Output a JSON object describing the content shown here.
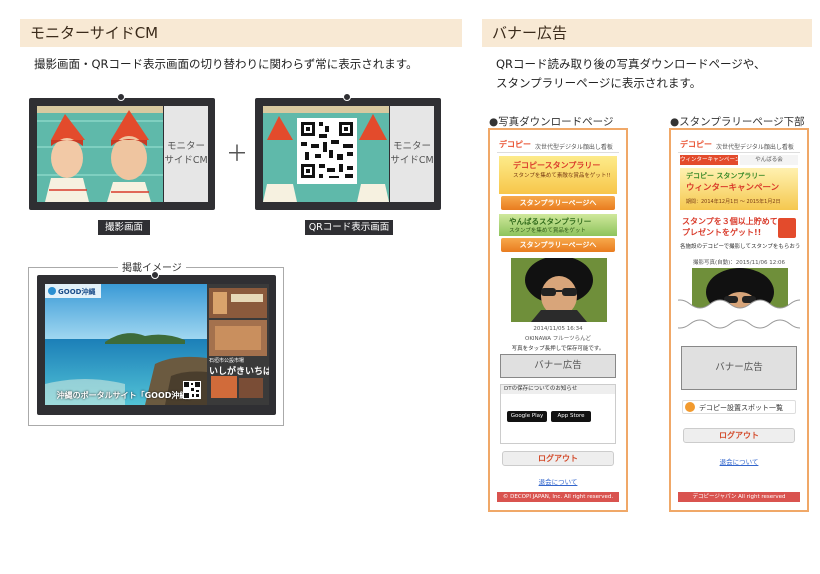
{
  "left": {
    "title": "モニターサイドCM",
    "description": "撮影画面・QRコード表示画面の切り替わりに関わらず常に表示されます。",
    "monitor1": {
      "cm_label": "モニター\nサイドCM",
      "caption": "撮影画面"
    },
    "plus": "＋",
    "monitor2": {
      "cm_label": "モニター\nサイドCM",
      "caption": "QRコード表示画面"
    },
    "image_label": "掲載イメージ",
    "ad": {
      "logo": "GOOD沖縄",
      "headline": "沖縄のポータルサイト「GOOD沖縄」",
      "shop_name": "いしがきいちば",
      "shop_sub": "石垣市公設市場",
      "colors": {
        "sea": "#2a8fc2",
        "sky": "#6bc0e8",
        "sand": "#d9c7a0"
      }
    }
  },
  "right": {
    "title": "バナー広告",
    "description_line1": "QRコード読み取り後の写真ダウンロードページや、",
    "description_line2": "スタンプラリーページに表示されます。",
    "phone1": {
      "label": "●写真ダウンロードページ",
      "header_logo": "デコピー",
      "header_text": "次世代型デジタル顔出し看板",
      "campaign1": "デコピースタンプラリー",
      "campaign1_sub": "スタンプを集めて素敵な賞品をゲット!!",
      "campaign1_btn": "スタンプラリーページへ",
      "campaign2": "やんばるスタンプラリー",
      "campaign2_sub": "スタンプを集めて賞品をゲット",
      "campaign2_btn": "スタンプラリーページへ",
      "photo_date": "2014/11/05 16:34",
      "photo_place": "OKINAWA フルーツらんど",
      "photo_note": "写真をタップ長押しで保存可能です。",
      "banner": "バナー広告",
      "app_title": "DTの保存についてのお知らせ",
      "google_play": "Google Play",
      "app_store": "App Store",
      "logout": "ログアウト",
      "about": "退会について",
      "footer": "© DECOPI JAPAN, Inc. All right reserved."
    },
    "phone2": {
      "label": "●スタンプラリーページ下部",
      "header_logo": "デコピー",
      "header_text": "次世代型デジタル顔出し看板",
      "tabs": [
        "ウィンターキャンペーン",
        "やんばる会"
      ],
      "campaign_title": "デコピー スタンプラリー",
      "campaign_main": "ウィンターキャンペーン",
      "campaign_date": "期間：2014年12月1日 〜 2015年1月2日",
      "promo_line1": "スタンプを３個以上貯めて",
      "promo_line2": "プレゼントをゲット!!",
      "promo_note": "各施設のデコピーで撮影してスタンプをもらおう",
      "shot_date": "撮影写真(自動)：2015/11/06 12:06",
      "banner": "バナー広告",
      "spot_button": "デコピー設置スポット一覧",
      "logout": "ログアウト",
      "about": "退会について",
      "footer": "デコピージャパン All right reserved"
    }
  }
}
